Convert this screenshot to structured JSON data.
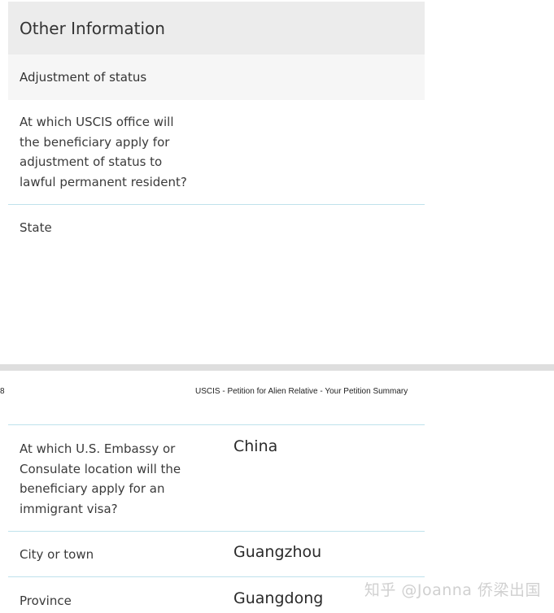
{
  "page1": {
    "section_title": "Other Information",
    "subsection_title": "Adjustment of status",
    "rows": [
      {
        "question": "At which USCIS office will the beneficiary apply for adjustment of status to lawful permanent resident?",
        "answer": ""
      },
      {
        "question": "State",
        "answer": ""
      }
    ]
  },
  "page2": {
    "page_number": "8",
    "page_title": "USCIS - Petition for Alien Relative - Your Petition Summary",
    "rows": [
      {
        "question": "At which U.S. Embassy or Consulate location will the beneficiary apply for an immigrant visa?",
        "answer": "China"
      },
      {
        "question": "City or town",
        "answer": "Guangzhou"
      },
      {
        "question": "Province",
        "answer": "Guangdong"
      }
    ]
  },
  "watermark": "知乎 @Joanna 侨梁出国"
}
